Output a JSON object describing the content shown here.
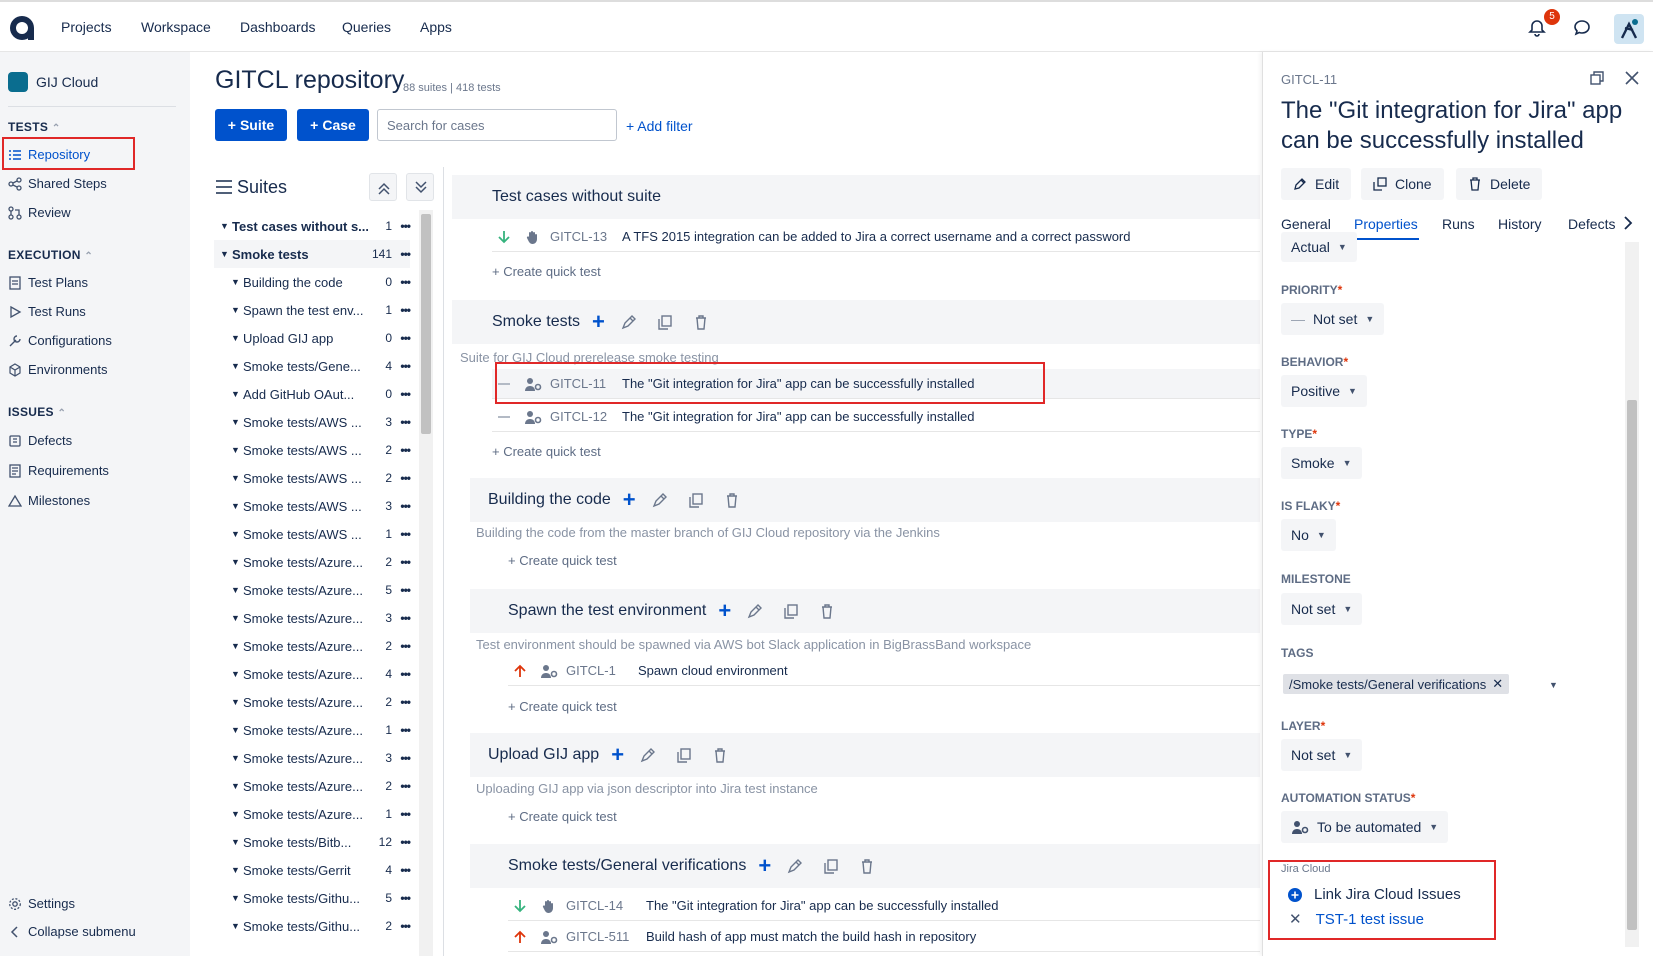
{
  "topnav": {
    "items": [
      "Projects",
      "Workspace",
      "Dashboards",
      "Queries",
      "Apps"
    ],
    "notification_count": "5"
  },
  "sidebar": {
    "project_name": "GIJ Cloud",
    "tests_heading": "TESTS",
    "tests_items": [
      "Repository",
      "Shared Steps",
      "Review"
    ],
    "execution_heading": "EXECUTION",
    "execution_items": [
      "Test Plans",
      "Test Runs",
      "Configurations",
      "Environments"
    ],
    "issues_heading": "ISSUES",
    "issues_items": [
      "Defects",
      "Requirements",
      "Milestones"
    ],
    "settings": "Settings",
    "collapse": "Collapse submenu"
  },
  "repository": {
    "title": "GITCL repository",
    "meta": "88 suites | 418 tests",
    "suite_button": "Suite",
    "case_button": "Case",
    "search_placeholder": "Search for cases",
    "add_filter": "+ Add filter"
  },
  "suites_panel": {
    "title": "Suites",
    "tree": [
      {
        "label": "Test cases without s...",
        "count": "1"
      },
      {
        "label": "Smoke tests",
        "count": "141"
      },
      {
        "label": "Building the code",
        "count": "0"
      },
      {
        "label": "Spawn the test env...",
        "count": "1"
      },
      {
        "label": "Upload GIJ app",
        "count": "0"
      },
      {
        "label": "Smoke tests/Gene...",
        "count": "4"
      },
      {
        "label": "Add GitHub OAut...",
        "count": "0"
      },
      {
        "label": "Smoke tests/AWS ...",
        "count": "3"
      },
      {
        "label": "Smoke tests/AWS ...",
        "count": "2"
      },
      {
        "label": "Smoke tests/AWS ...",
        "count": "2"
      },
      {
        "label": "Smoke tests/AWS ...",
        "count": "3"
      },
      {
        "label": "Smoke tests/AWS ...",
        "count": "1"
      },
      {
        "label": "Smoke tests/Azure...",
        "count": "2"
      },
      {
        "label": "Smoke tests/Azure...",
        "count": "5"
      },
      {
        "label": "Smoke tests/Azure...",
        "count": "3"
      },
      {
        "label": "Smoke tests/Azure...",
        "count": "2"
      },
      {
        "label": "Smoke tests/Azure...",
        "count": "4"
      },
      {
        "label": "Smoke tests/Azure...",
        "count": "2"
      },
      {
        "label": "Smoke tests/Azure...",
        "count": "1"
      },
      {
        "label": "Smoke tests/Azure...",
        "count": "3"
      },
      {
        "label": "Smoke tests/Azure...",
        "count": "2"
      },
      {
        "label": "Smoke tests/Azure...",
        "count": "1"
      },
      {
        "label": "Smoke tests/Bitb...",
        "count": "12"
      },
      {
        "label": "Smoke tests/Gerrit",
        "count": "4"
      },
      {
        "label": "Smoke tests/Githu...",
        "count": "5"
      },
      {
        "label": "Smoke tests/Githu...",
        "count": "2"
      }
    ]
  },
  "suites": {
    "without_suite": {
      "title": "Test cases without suite",
      "cases": [
        {
          "key": "GITCL-13",
          "name": "A TFS 2015 integration can be added to Jira a correct username and a correct password"
        }
      ]
    },
    "smoke": {
      "title": "Smoke tests",
      "description": "Suite for GIJ Cloud prerelease smoke testing",
      "cases": [
        {
          "key": "GITCL-11",
          "name": "The \"Git integration for Jira\" app can be successfully installed"
        },
        {
          "key": "GITCL-12",
          "name": "The \"Git integration for Jira\" app can be successfully installed"
        }
      ]
    },
    "building": {
      "title": "Building the code",
      "description": "Building the code from the master branch of GIJ Cloud repository via the Jenkins"
    },
    "spawn": {
      "title": "Spawn the test environment",
      "description": "Test environment should be spawned via AWS bot Slack application in BigBrassBand workspace",
      "cases": [
        {
          "key": "GITCL-1",
          "name": "Spawn cloud environment"
        }
      ]
    },
    "upload": {
      "title": "Upload GIJ app",
      "description": "Uploading GIJ app via json descriptor into Jira test instance"
    },
    "general": {
      "title": "Smoke tests/General verifications",
      "cases": [
        {
          "key": "GITCL-14",
          "name": "The \"Git integration for Jira\" app can be successfully installed"
        },
        {
          "key": "GITCL-511",
          "name": "Build hash of app must match the build hash in repository"
        }
      ]
    },
    "create_quick_test": "+ Create quick test"
  },
  "detail": {
    "key": "GITCL-11",
    "title": "The \"Git integration for Jira\" app can be successfully installed",
    "buttons": [
      "Edit",
      "Clone",
      "Delete"
    ],
    "tabs": [
      "General",
      "Properties",
      "Runs",
      "History",
      "Defects"
    ],
    "fields": {
      "status_value": "Actual",
      "priority_label": "PRIORITY",
      "priority_value": "Not set",
      "behavior_label": "BEHAVIOR",
      "behavior_value": "Positive",
      "type_label": "TYPE",
      "type_value": "Smoke",
      "flaky_label": "IS FLAKY",
      "flaky_value": "No",
      "milestone_label": "MILESTONE",
      "milestone_value": "Not set",
      "tags_label": "TAGS",
      "tag_value": "/Smoke tests/General verifications",
      "layer_label": "LAYER",
      "layer_value": "Not set",
      "automation_label": "AUTOMATION STATUS",
      "automation_value": "To be automated"
    },
    "jira": {
      "caption": "Jira Cloud",
      "link_label": "Link Jira Cloud Issues",
      "issue": "TST-1 test issue"
    }
  },
  "colors": {
    "accent": "#0052cc",
    "highlight": "#e02828",
    "arrow_up": "#de350b",
    "arrow_down": "#36b37e"
  }
}
